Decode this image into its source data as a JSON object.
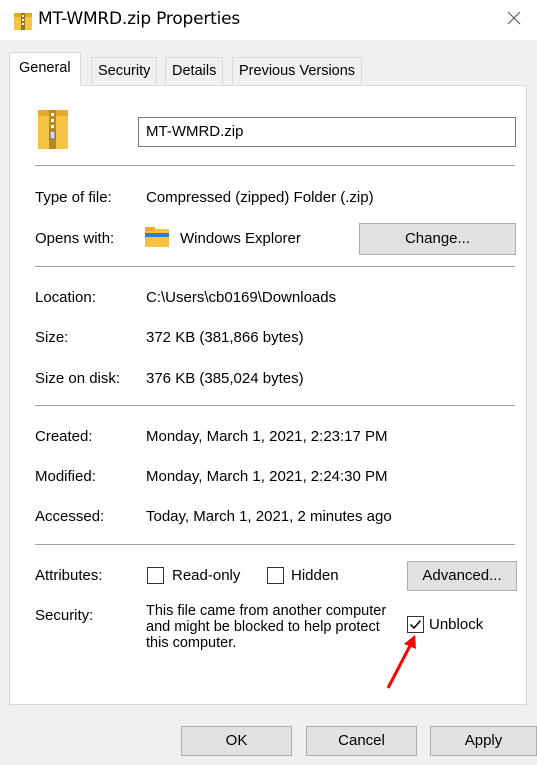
{
  "window": {
    "title": "MT-WMRD.zip Properties",
    "close_glyph": "✕",
    "title_icon": "zip-folder-icon"
  },
  "tabs": [
    {
      "label": "General",
      "active": true
    },
    {
      "label": "Security",
      "active": false
    },
    {
      "label": "Details",
      "active": false
    },
    {
      "label": "Previous Versions",
      "active": false
    }
  ],
  "general": {
    "filename": "MT-WMRD.zip",
    "type_label": "Type of file:",
    "type_value": "Compressed (zipped) Folder (.zip)",
    "opens_label": "Opens with:",
    "opens_value": "Windows Explorer",
    "opens_icon": "file-explorer-icon",
    "change_label": "Change...",
    "location_label": "Location:",
    "location_value": "C:\\Users\\cb0169\\Downloads",
    "size_label": "Size:",
    "size_value": "372 KB (381,866 bytes)",
    "size_on_disk_label": "Size on disk:",
    "size_on_disk_value": "376 KB (385,024 bytes)",
    "created_label": "Created:",
    "created_value": "Monday, March 1, 2021, 2:23:17 PM",
    "modified_label": "Modified:",
    "modified_value": "Monday, March 1, 2021, 2:24:30 PM",
    "accessed_label": "Accessed:",
    "accessed_value": "Today, March 1, 2021, 2 minutes ago",
    "attributes_label": "Attributes:",
    "readonly_label": "Read-only",
    "readonly_checked": false,
    "hidden_label": "Hidden",
    "hidden_checked": false,
    "advanced_label": "Advanced...",
    "security_label": "Security:",
    "security_message": "This file came from another computer and might be blocked to help protect this computer.",
    "unblock_label": "Unblock",
    "unblock_checked": true
  },
  "buttons": {
    "ok": "OK",
    "cancel": "Cancel",
    "apply": "Apply"
  },
  "annotation": {
    "arrow_color": "#ff0000"
  }
}
